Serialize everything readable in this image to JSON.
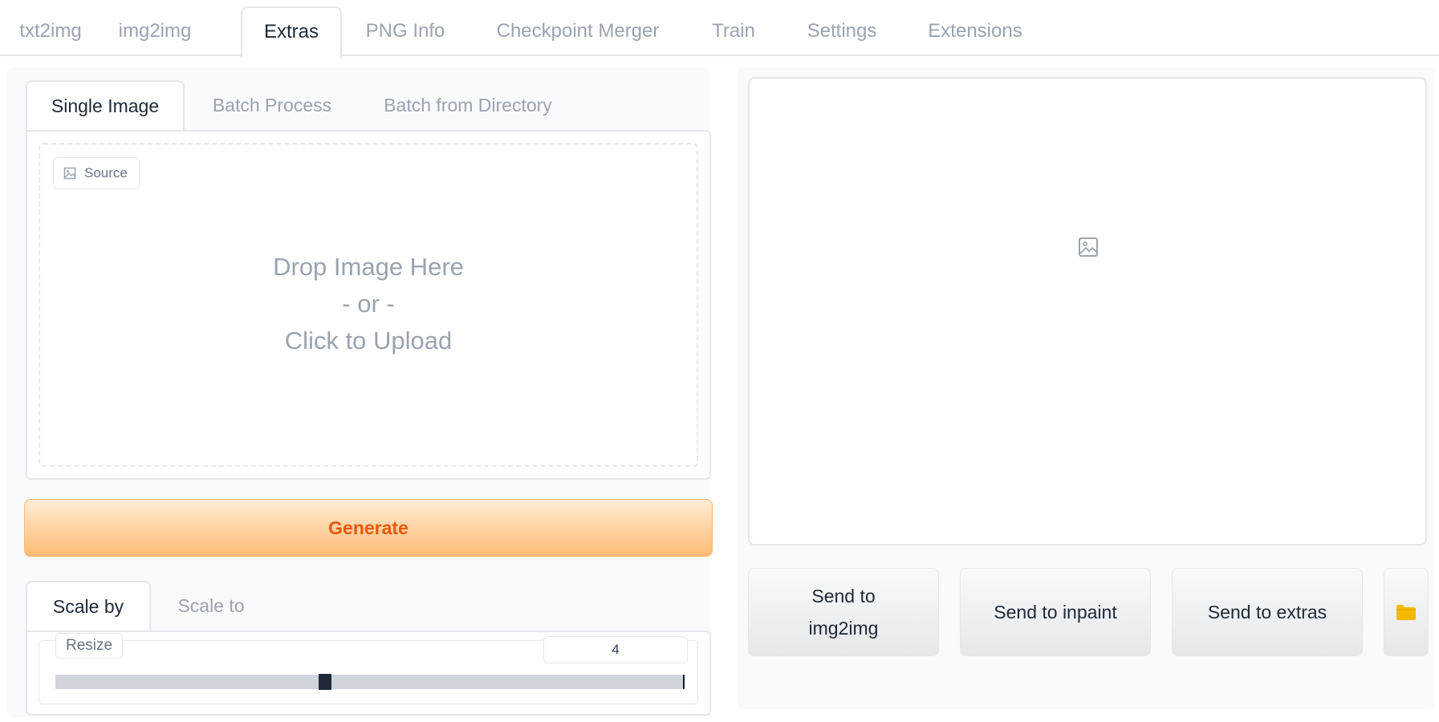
{
  "top_tabs": [
    "txt2img",
    "img2img",
    "Extras",
    "PNG Info",
    "Checkpoint Merger",
    "Train",
    "Settings",
    "Extensions"
  ],
  "active_top_tab": "Extras",
  "input_tabs": [
    "Single Image",
    "Batch Process",
    "Batch from Directory"
  ],
  "active_input_tab": "Single Image",
  "upload": {
    "label": "Source",
    "drop_text": "Drop Image Here",
    "or_text": "- or -",
    "click_text": "Click to Upload"
  },
  "generate_label": "Generate",
  "scale_tabs": [
    "Scale by",
    "Scale to"
  ],
  "active_scale_tab": "Scale by",
  "resize": {
    "label": "Resize",
    "value": "4",
    "fraction": 0.43
  },
  "output": {
    "send_img2img_line1": "Send to",
    "send_img2img_line2": "img2img",
    "send_inpaint": "Send to inpaint",
    "send_extras": "Send to extras"
  },
  "colors": {
    "generate_text": "#ea580c",
    "generate_gradient_end": "#fdba74",
    "folder_icon": "#f5b800"
  }
}
